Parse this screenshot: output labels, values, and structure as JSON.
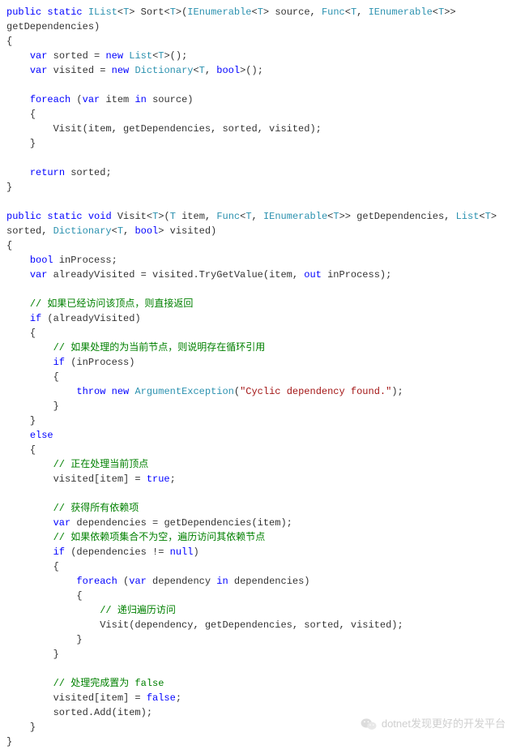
{
  "code": {
    "tokens": [
      {
        "c": "kw",
        "t": "public"
      },
      {
        "t": " "
      },
      {
        "c": "kw",
        "t": "static"
      },
      {
        "t": " "
      },
      {
        "c": "tp",
        "t": "IList"
      },
      {
        "t": "<"
      },
      {
        "c": "tp",
        "t": "T"
      },
      {
        "t": "> Sort<"
      },
      {
        "c": "tp",
        "t": "T"
      },
      {
        "t": ">("
      },
      {
        "c": "tp",
        "t": "IEnumerable"
      },
      {
        "t": "<"
      },
      {
        "c": "tp",
        "t": "T"
      },
      {
        "t": "> source, "
      },
      {
        "c": "tp",
        "t": "Func"
      },
      {
        "t": "<"
      },
      {
        "c": "tp",
        "t": "T"
      },
      {
        "t": ", "
      },
      {
        "c": "tp",
        "t": "IEnumerable"
      },
      {
        "t": "<"
      },
      {
        "c": "tp",
        "t": "T"
      },
      {
        "t": ">> getDependencies)\n{\n    "
      },
      {
        "c": "kw",
        "t": "var"
      },
      {
        "t": " sorted = "
      },
      {
        "c": "kw",
        "t": "new"
      },
      {
        "t": " "
      },
      {
        "c": "tp",
        "t": "List"
      },
      {
        "t": "<"
      },
      {
        "c": "tp",
        "t": "T"
      },
      {
        "t": ">();\n    "
      },
      {
        "c": "kw",
        "t": "var"
      },
      {
        "t": " visited = "
      },
      {
        "c": "kw",
        "t": "new"
      },
      {
        "t": " "
      },
      {
        "c": "tp",
        "t": "Dictionary"
      },
      {
        "t": "<"
      },
      {
        "c": "tp",
        "t": "T"
      },
      {
        "t": ", "
      },
      {
        "c": "kw",
        "t": "bool"
      },
      {
        "t": ">();\n\n    "
      },
      {
        "c": "kw",
        "t": "foreach"
      },
      {
        "t": " ("
      },
      {
        "c": "kw",
        "t": "var"
      },
      {
        "t": " item "
      },
      {
        "c": "kw",
        "t": "in"
      },
      {
        "t": " source)\n    {\n        Visit(item, getDependencies, sorted, visited);\n    }\n\n    "
      },
      {
        "c": "kw",
        "t": "return"
      },
      {
        "t": " sorted;\n}\n\n"
      },
      {
        "c": "kw",
        "t": "public"
      },
      {
        "t": " "
      },
      {
        "c": "kw",
        "t": "static"
      },
      {
        "t": " "
      },
      {
        "c": "kw",
        "t": "void"
      },
      {
        "t": " Visit<"
      },
      {
        "c": "tp",
        "t": "T"
      },
      {
        "t": ">("
      },
      {
        "c": "tp",
        "t": "T"
      },
      {
        "t": " item, "
      },
      {
        "c": "tp",
        "t": "Func"
      },
      {
        "t": "<"
      },
      {
        "c": "tp",
        "t": "T"
      },
      {
        "t": ", "
      },
      {
        "c": "tp",
        "t": "IEnumerable"
      },
      {
        "t": "<"
      },
      {
        "c": "tp",
        "t": "T"
      },
      {
        "t": ">> getDependencies, "
      },
      {
        "c": "tp",
        "t": "List"
      },
      {
        "t": "<"
      },
      {
        "c": "tp",
        "t": "T"
      },
      {
        "t": "> sorted, "
      },
      {
        "c": "tp",
        "t": "Dictionary"
      },
      {
        "t": "<"
      },
      {
        "c": "tp",
        "t": "T"
      },
      {
        "t": ", "
      },
      {
        "c": "kw",
        "t": "bool"
      },
      {
        "t": "> visited)\n{\n    "
      },
      {
        "c": "kw",
        "t": "bool"
      },
      {
        "t": " inProcess;\n    "
      },
      {
        "c": "kw",
        "t": "var"
      },
      {
        "t": " alreadyVisited = visited.TryGetValue(item, "
      },
      {
        "c": "kw",
        "t": "out"
      },
      {
        "t": " inProcess);\n\n    "
      },
      {
        "c": "cm",
        "t": "// 如果已经访问该顶点，则直接返回"
      },
      {
        "t": "\n    "
      },
      {
        "c": "kw",
        "t": "if"
      },
      {
        "t": " (alreadyVisited)\n    {\n        "
      },
      {
        "c": "cm",
        "t": "// 如果处理的为当前节点，则说明存在循环引用"
      },
      {
        "t": "\n        "
      },
      {
        "c": "kw",
        "t": "if"
      },
      {
        "t": " (inProcess)\n        {\n            "
      },
      {
        "c": "kw",
        "t": "throw"
      },
      {
        "t": " "
      },
      {
        "c": "kw",
        "t": "new"
      },
      {
        "t": " "
      },
      {
        "c": "tp",
        "t": "ArgumentException"
      },
      {
        "t": "("
      },
      {
        "c": "st",
        "t": "\"Cyclic dependency found.\""
      },
      {
        "t": ");\n        }\n    }\n    "
      },
      {
        "c": "kw",
        "t": "else"
      },
      {
        "t": "\n    {\n        "
      },
      {
        "c": "cm",
        "t": "// 正在处理当前顶点"
      },
      {
        "t": "\n        visited[item] = "
      },
      {
        "c": "kw",
        "t": "true"
      },
      {
        "t": ";\n\n        "
      },
      {
        "c": "cm",
        "t": "// 获得所有依赖项"
      },
      {
        "t": "\n        "
      },
      {
        "c": "kw",
        "t": "var"
      },
      {
        "t": " dependencies = getDependencies(item);\n        "
      },
      {
        "c": "cm",
        "t": "// 如果依赖项集合不为空，遍历访问其依赖节点"
      },
      {
        "t": "\n        "
      },
      {
        "c": "kw",
        "t": "if"
      },
      {
        "t": " (dependencies != "
      },
      {
        "c": "kw",
        "t": "null"
      },
      {
        "t": ")\n        {\n            "
      },
      {
        "c": "kw",
        "t": "foreach"
      },
      {
        "t": " ("
      },
      {
        "c": "kw",
        "t": "var"
      },
      {
        "t": " dependency "
      },
      {
        "c": "kw",
        "t": "in"
      },
      {
        "t": " dependencies)\n            {\n                "
      },
      {
        "c": "cm",
        "t": "// 递归遍历访问"
      },
      {
        "t": "\n                Visit(dependency, getDependencies, sorted, visited);\n            }\n        }\n\n        "
      },
      {
        "c": "cm",
        "t": "// 处理完成置为 false"
      },
      {
        "t": "\n        visited[item] = "
      },
      {
        "c": "kw",
        "t": "false"
      },
      {
        "t": ";\n        sorted.Add(item);\n    }\n}"
      }
    ]
  },
  "footer": {
    "text": "dotnet发现更好的开发平台"
  }
}
